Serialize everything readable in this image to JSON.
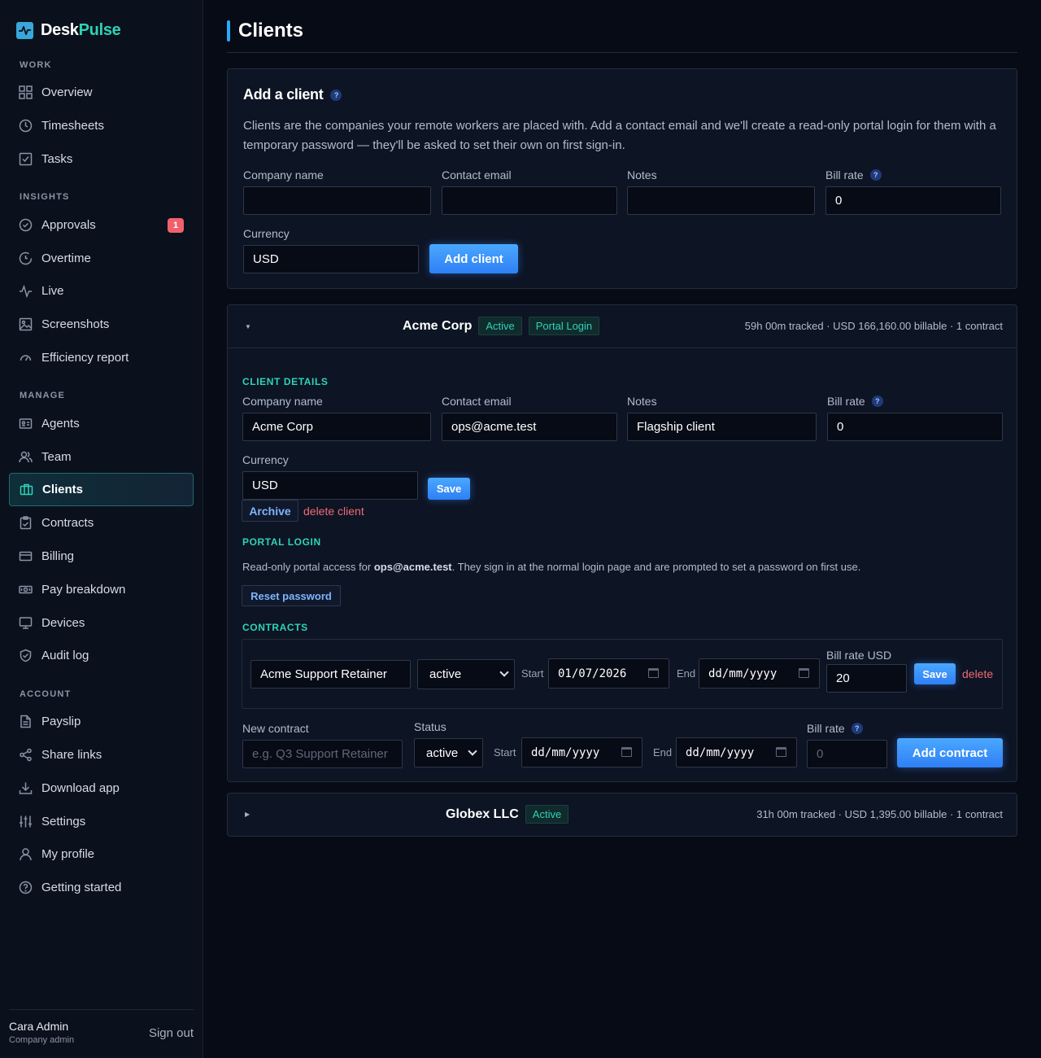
{
  "brand": {
    "part1": "Desk",
    "part2": "Pulse"
  },
  "sidebar": {
    "sections": {
      "work": "WORK",
      "insights": "INSIGHTS",
      "manage": "MANAGE",
      "account": "ACCOUNT"
    },
    "items": {
      "overview": "Overview",
      "timesheets": "Timesheets",
      "tasks": "Tasks",
      "approvals": "Approvals",
      "approvals_badge": "1",
      "overtime": "Overtime",
      "live": "Live",
      "screenshots": "Screenshots",
      "efficiency": "Efficiency report",
      "agents": "Agents",
      "team": "Team",
      "clients": "Clients",
      "contracts": "Contracts",
      "billing": "Billing",
      "pay_breakdown": "Pay breakdown",
      "devices": "Devices",
      "audit_log": "Audit log",
      "payslip": "Payslip",
      "share_links": "Share links",
      "download_app": "Download app",
      "settings": "Settings",
      "my_profile": "My profile",
      "getting_started": "Getting started"
    },
    "user": {
      "name": "Cara Admin",
      "role": "Company admin",
      "signout": "Sign out"
    }
  },
  "page": {
    "title": "Clients"
  },
  "add_client": {
    "title": "Add a client",
    "help": "?",
    "description": "Clients are the companies your remote workers are placed with. Add a contact email and we'll create a read-only portal login for them with a temporary password — they'll be asked to set their own on first sign-in.",
    "labels": {
      "company": "Company name",
      "email": "Contact email",
      "notes": "Notes",
      "bill_rate": "Bill rate",
      "currency": "Currency"
    },
    "values": {
      "company": "",
      "email": "",
      "notes": "",
      "bill_rate": "0",
      "currency": "USD"
    },
    "button": "Add client"
  },
  "clients": [
    {
      "name": "Acme Corp",
      "status": "Active",
      "portal": "Portal Login",
      "meta": "59h 00m tracked · USD 166,160.00 billable · 1 contract",
      "details": {
        "heading": "CLIENT DETAILS",
        "labels": {
          "company": "Company name",
          "email": "Contact email",
          "notes": "Notes",
          "bill_rate": "Bill rate",
          "currency": "Currency"
        },
        "values": {
          "company": "Acme Corp",
          "email": "ops@acme.test",
          "notes": "Flagship client",
          "bill_rate": "0",
          "currency": "USD"
        },
        "save": "Save",
        "archive": "Archive",
        "delete": "delete client"
      },
      "portal_section": {
        "heading": "PORTAL LOGIN",
        "text_pre": "Read-only portal access for ",
        "email": "ops@acme.test",
        "text_post": ". They sign in at the normal login page and are prompted to set a password on first use.",
        "reset": "Reset password"
      },
      "contracts": {
        "heading": "CONTRACTS",
        "rows": [
          {
            "name": "Acme Support Retainer",
            "status": "active",
            "start_label": "Start",
            "start": "01/07/2026",
            "end_label": "End",
            "end": "dd/mm/yyyy",
            "rate_label": "Bill rate USD",
            "rate": "20",
            "save": "Save",
            "delete": "delete"
          }
        ],
        "new": {
          "name_label": "New contract",
          "name_placeholder": "e.g. Q3 Support Retainer",
          "status_label": "Status",
          "status": "active",
          "start_label": "Start",
          "start": "dd/mm/yyyy",
          "end_label": "End",
          "end": "dd/mm/yyyy",
          "rate_label": "Bill rate",
          "rate_placeholder": "0",
          "button": "Add contract"
        }
      }
    },
    {
      "name": "Globex LLC",
      "status": "Active",
      "meta": "31h 00m tracked · USD 1,395.00 billable · 1 contract"
    }
  ],
  "icons": {
    "overview": "grid-icon",
    "timesheets": "clock-icon",
    "tasks": "checkbox-icon",
    "approvals": "check-circle-icon",
    "overtime": "timer-icon",
    "live": "pulse-icon",
    "screenshots": "image-icon",
    "efficiency": "gauge-icon",
    "agents": "id-card-icon",
    "team": "users-icon",
    "clients": "briefcase-icon",
    "contracts": "clipboard-icon",
    "billing": "credit-card-icon",
    "pay_breakdown": "cash-icon",
    "devices": "monitor-icon",
    "audit_log": "shield-icon",
    "payslip": "document-icon",
    "share_links": "share-icon",
    "download_app": "download-icon",
    "settings": "sliders-icon",
    "my_profile": "user-icon",
    "getting_started": "help-circle-icon"
  },
  "colors": {
    "accent": "#2ed3b7",
    "primary": "#2f7ff5",
    "danger": "#ef6b73",
    "background": "#070b15"
  }
}
